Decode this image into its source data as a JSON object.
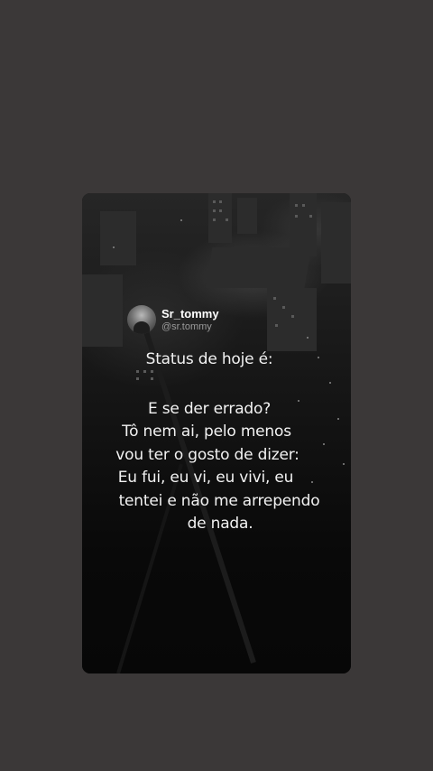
{
  "post": {
    "username": "Sr_tommy",
    "handle": "@sr.tommy",
    "title": "Status de hoje é:",
    "lines": [
      "E se der errado?",
      "Tô nem ai, pelo menos",
      "vou ter o gosto de dizer:",
      "Eu fui, eu vi, eu vivi, eu",
      "tentei e não me arrependo",
      "de nada."
    ]
  },
  "colors": {
    "page_background": "#3b3838",
    "text": "#f2f2f2",
    "handle": "#9a9a9a"
  }
}
